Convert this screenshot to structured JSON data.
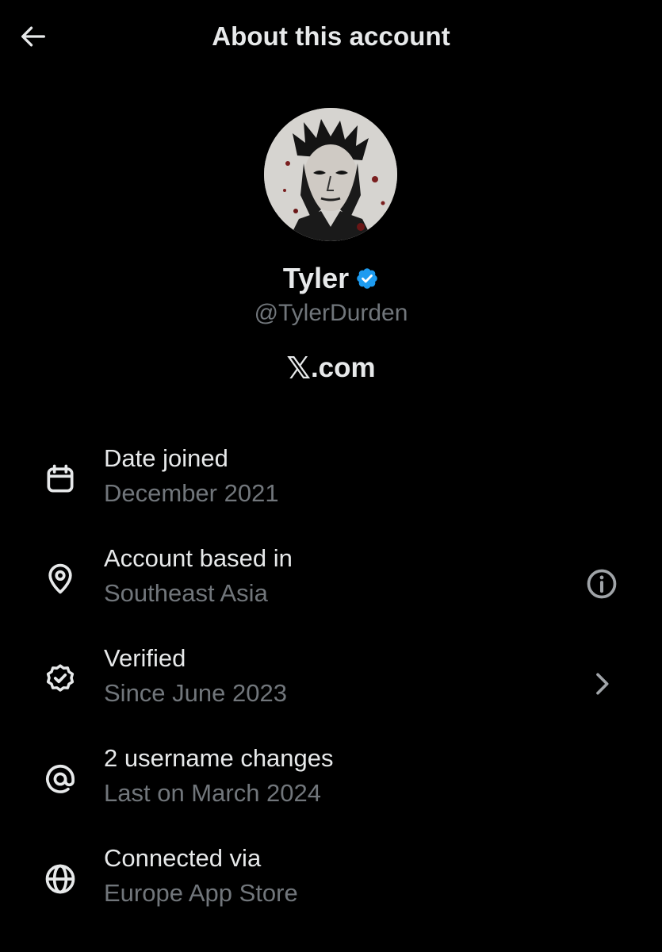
{
  "header": {
    "title": "About this account",
    "back_icon": "arrow-left-icon"
  },
  "profile": {
    "name": "Tyler",
    "handle": "@TylerDurden",
    "verified": true,
    "verified_color": "#1d9bf0",
    "site_logo": "𝕏",
    "site_text": ".com"
  },
  "items": [
    {
      "icon": "calendar-icon",
      "label": "Date joined",
      "value": "December 2021",
      "action_icon": null
    },
    {
      "icon": "location-pin-icon",
      "label": "Account based in",
      "value": "Southeast Asia",
      "action_icon": "info-icon"
    },
    {
      "icon": "verified-badge-icon",
      "label": "Verified",
      "value": "Since June 2023",
      "action_icon": "chevron-right-icon"
    },
    {
      "icon": "at-sign-icon",
      "label": "2 username changes",
      "value": "Last on March 2024",
      "action_icon": null
    },
    {
      "icon": "globe-icon",
      "label": "Connected via",
      "value": "Europe App Store",
      "action_icon": null
    }
  ],
  "colors": {
    "background": "#000000",
    "primary_text": "#e7e9ea",
    "secondary_text": "#71767b",
    "accent": "#1d9bf0"
  }
}
